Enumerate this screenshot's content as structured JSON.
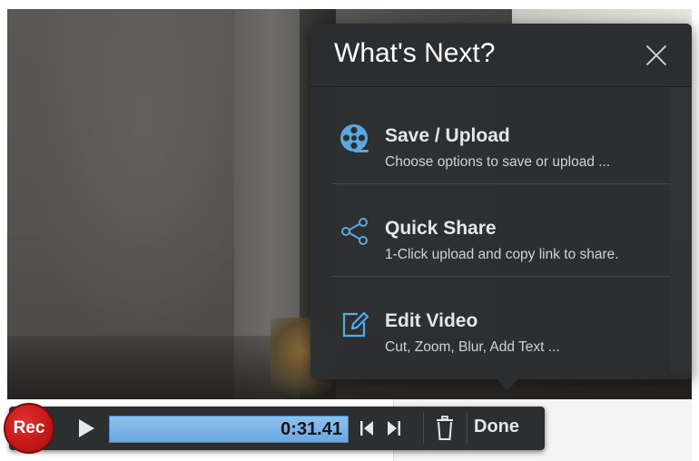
{
  "popup": {
    "title": "What's Next?",
    "items": [
      {
        "label": "Save / Upload",
        "description": "Choose options to save or upload ...",
        "icon": "film-reel-icon"
      },
      {
        "label": "Quick Share",
        "description": "1-Click upload and copy link to share.",
        "icon": "share-icon"
      },
      {
        "label": "Edit Video",
        "description": "Cut, Zoom, Blur, Add Text ...",
        "icon": "edit-icon"
      }
    ]
  },
  "controls": {
    "rec_label": "Rec",
    "time": "0:31.41",
    "done_label": "Done"
  },
  "colors": {
    "accent_icon": "#5aa8e0",
    "rec_red": "#c21818",
    "progress_blue": "#6aa7e2",
    "panel_bg": "#2c2e30"
  }
}
